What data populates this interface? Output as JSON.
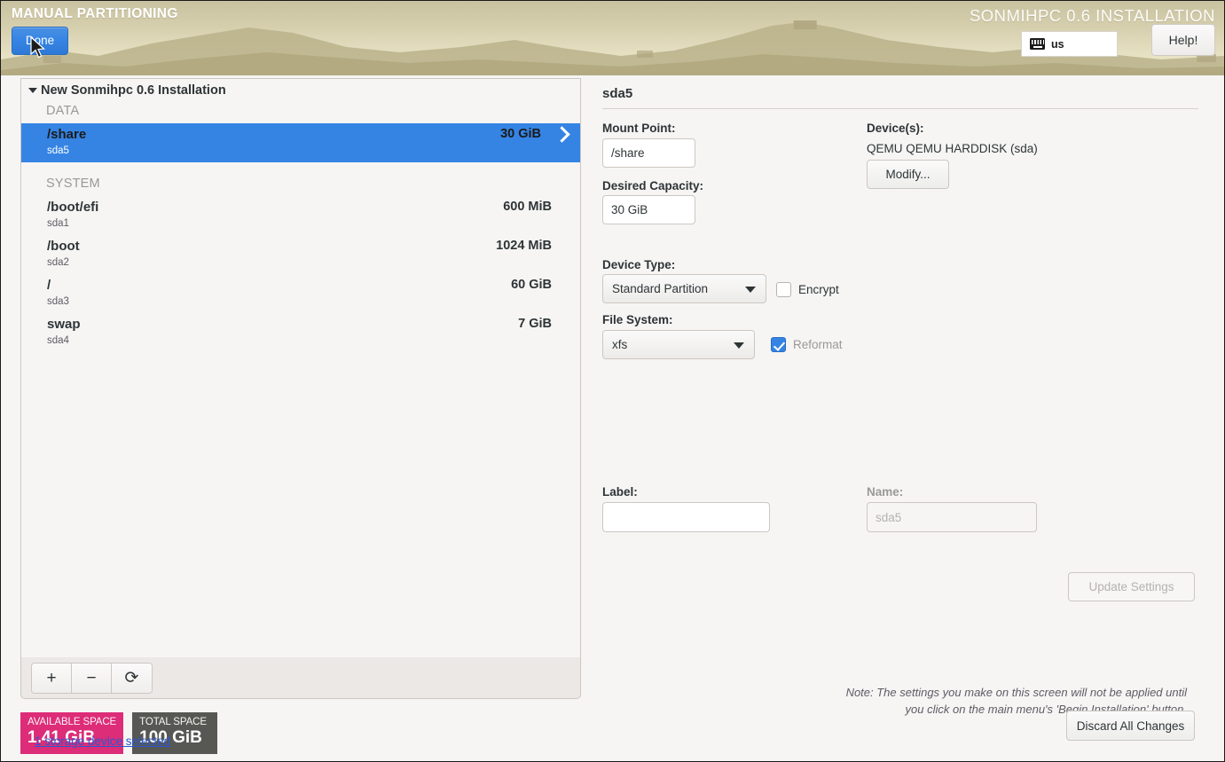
{
  "header": {
    "page_label": "MANUAL PARTITIONING",
    "product_title": "SONMIHPC 0.6 INSTALLATION",
    "done_label": "Done",
    "help_label": "Help!",
    "keyboard_layout": "us",
    "keyboard_icon": "keyboard-icon"
  },
  "left": {
    "tree_root_label": "New Sonmihpc 0.6 Installation",
    "groups": [
      {
        "name": "DATA",
        "partitions": [
          {
            "mount": "/share",
            "device": "sda5",
            "size": "30 GiB",
            "selected": true
          }
        ]
      },
      {
        "name": "SYSTEM",
        "partitions": [
          {
            "mount": "/boot/efi",
            "device": "sda1",
            "size": "600 MiB",
            "selected": false
          },
          {
            "mount": "/boot",
            "device": "sda2",
            "size": "1024 MiB",
            "selected": false
          },
          {
            "mount": "/",
            "device": "sda3",
            "size": "60 GiB",
            "selected": false
          },
          {
            "mount": "swap",
            "device": "sda4",
            "size": "7 GiB",
            "selected": false
          }
        ]
      }
    ],
    "toolbar": {
      "add_label": "+",
      "remove_label": "−",
      "reset_label": "⟳"
    },
    "available_space": {
      "caption": "AVAILABLE SPACE",
      "value": "1.41 GiB",
      "color": "#dd2c78"
    },
    "total_space": {
      "caption": "TOTAL SPACE",
      "value": "100 GiB",
      "color": "#575753"
    },
    "device_link": "1 storage device selected"
  },
  "right": {
    "title": "sda5",
    "mount_point": {
      "label": "Mount Point:",
      "value": "/share"
    },
    "desired_capacity": {
      "label": "Desired Capacity:",
      "value": "30 GiB"
    },
    "device_type": {
      "label": "Device Type:",
      "value": "Standard Partition"
    },
    "encrypt": {
      "label": "Encrypt",
      "checked": false
    },
    "file_system": {
      "label": "File System:",
      "value": "xfs"
    },
    "reformat": {
      "label": "Reformat",
      "checked": true
    },
    "devices": {
      "label": "Device(s):",
      "value": "QEMU QEMU HARDDISK (sda)",
      "modify_label": "Modify..."
    },
    "label_field": {
      "label": "Label:",
      "value": ""
    },
    "name_field": {
      "label": "Name:",
      "placeholder": "sda5"
    },
    "update_settings_label": "Update Settings",
    "note": "Note:  The settings you make on this screen will not be applied until you click on the main menu's 'Begin Installation' button.",
    "discard_label": "Discard All Changes"
  },
  "colors": {
    "accent_blue": "#3584e4",
    "available_pink": "#dd2c78",
    "total_gray": "#575753",
    "link_blue": "#2a58d0"
  }
}
